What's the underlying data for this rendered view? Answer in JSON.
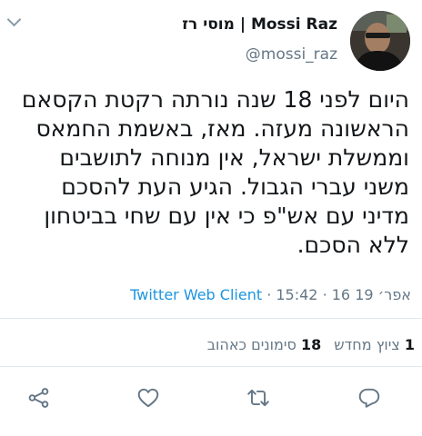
{
  "tweet": {
    "author": {
      "display_name": "מוסי רז | Mossi Raz",
      "handle": "@mossi_raz"
    },
    "text": "היום לפני 18 שנה נורתה רקטת הקסאם הראשונה מעזה. מאז, באשמת החמאס וממשלת ישראל, אין מנוחה לתושבים משני עברי הגבול. הגיע העת להסכם מדיני עם אש\"פ כי אין עם שחי בביטחון ללא הסכם.",
    "timestamp": "15:42 · 16 אפר׳ 19",
    "separator": " · ",
    "client": "Twitter Web Client"
  },
  "stats": {
    "retweet_count": "1",
    "retweet_label": "ציוץ מחדש",
    "like_count": "18",
    "like_label": "סימונים כאהוב"
  },
  "actions": {
    "icons": [
      "share-icon",
      "like-icon",
      "retweet-icon",
      "reply-icon"
    ],
    "icon_color": "#657786"
  },
  "colors": {
    "link": "#1b95e0",
    "secondary_text": "#657786",
    "divider": "#e1e8ed"
  }
}
